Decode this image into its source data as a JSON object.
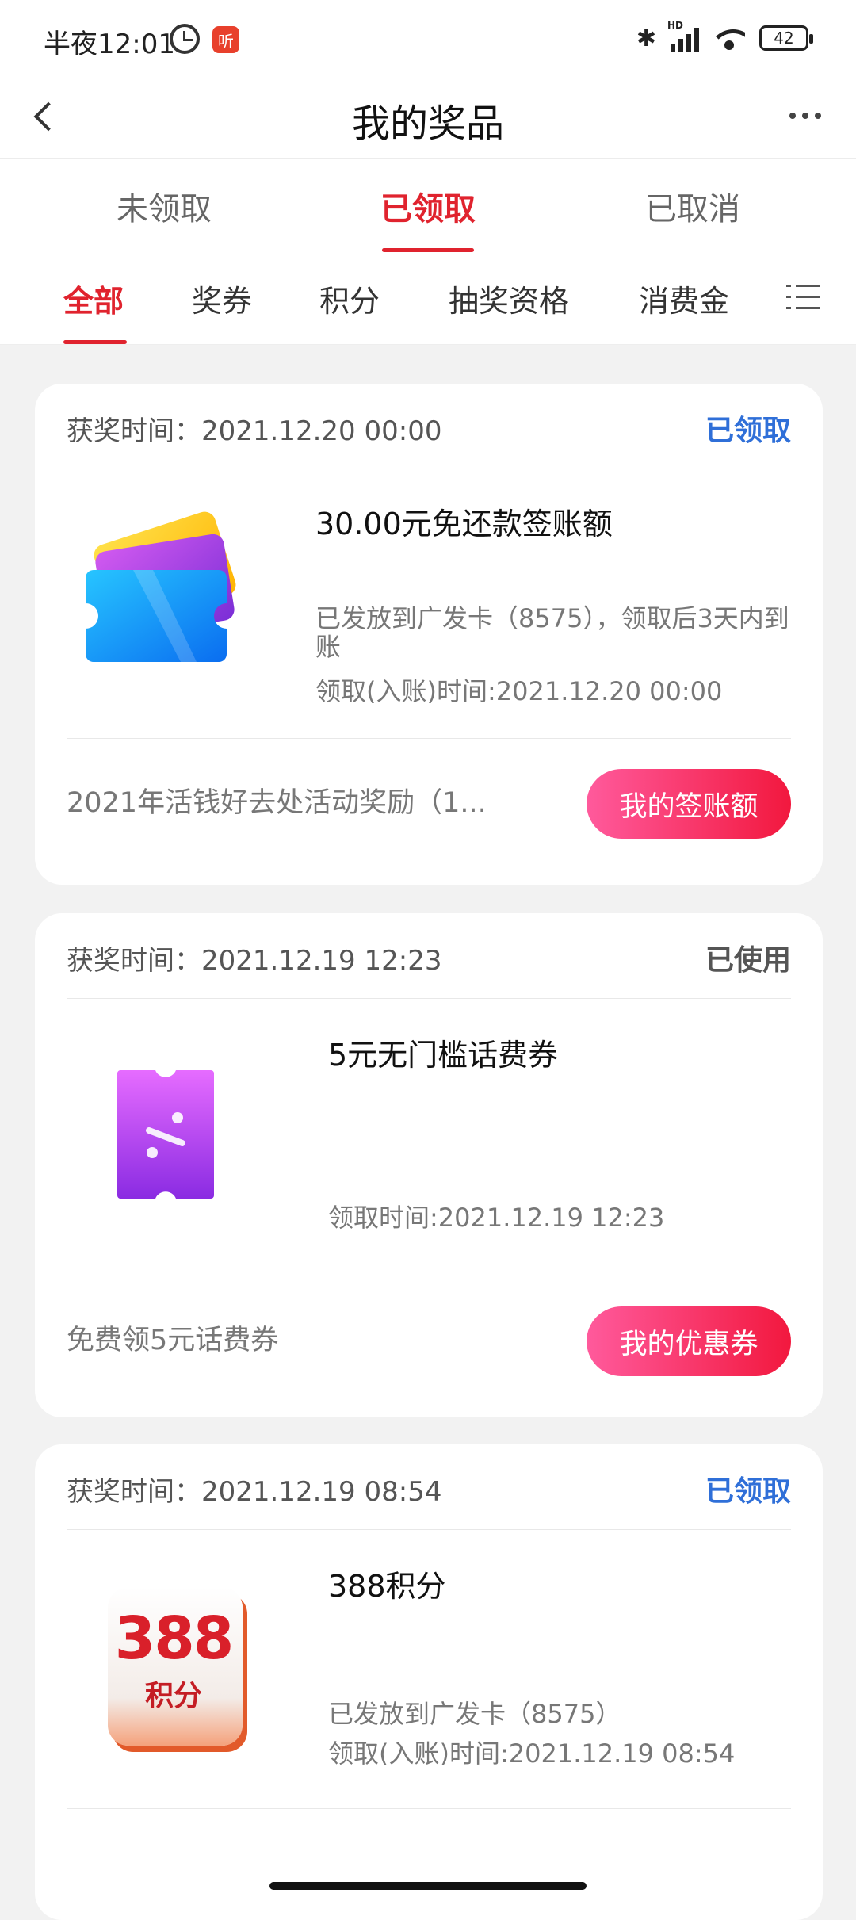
{
  "status_bar": {
    "time": "半夜12:01",
    "app_icon_text": "听",
    "network_label": "HD",
    "battery": "42"
  },
  "nav": {
    "title": "我的奖品"
  },
  "tabs": [
    {
      "label": "未领取",
      "active": false
    },
    {
      "label": "已领取",
      "active": true
    },
    {
      "label": "已取消",
      "active": false
    }
  ],
  "categories": [
    {
      "label": "全部",
      "active": true
    },
    {
      "label": "奖券",
      "active": false
    },
    {
      "label": "积分",
      "active": false
    },
    {
      "label": "抽奖资格",
      "active": false
    },
    {
      "label": "消费金",
      "active": false
    }
  ],
  "cards": [
    {
      "time": "获奖时间：2021.12.20 00:00",
      "status": "已领取",
      "name": "30.00元免还款签账额",
      "desc": "已发放到广发卡（8575），领取后3天内到账",
      "receive_time": "领取(入账)时间:2021.12.20 00:00",
      "source": "2021年活钱好去处活动奖励（1...",
      "button": "我的签账额",
      "icon": "ticket-stack-icon"
    },
    {
      "time": "获奖时间：2021.12.19 12:23",
      "status": "已使用",
      "name": "5元无门槛话费券",
      "receive_time": "领取时间:2021.12.19 12:23",
      "source": "免费领5元话费券",
      "button": "我的优惠券",
      "icon": "coupon-icon"
    },
    {
      "time": "获奖时间：2021.12.19 08:54",
      "status": "已领取",
      "name": "388积分",
      "desc": "已发放到广发卡（8575）",
      "receive_time": "领取(入账)时间:2021.12.19 08:54",
      "icon_number": "388",
      "icon_label": "积分",
      "icon": "points-badge-icon"
    }
  ],
  "colors": {
    "accent_red": "#e0232e",
    "status_blue": "#2f6fd8",
    "button_gradient_start": "#ff5a9c",
    "button_gradient_end": "#f2183e"
  }
}
